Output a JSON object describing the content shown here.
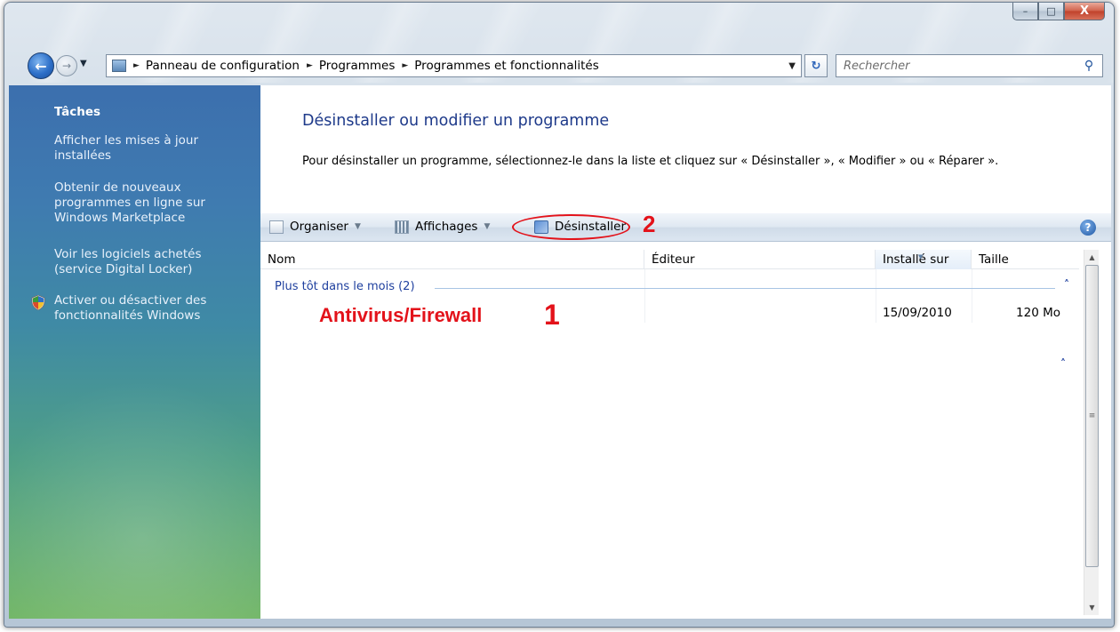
{
  "window": {
    "caption": {
      "minimize": "–",
      "maximize": "□",
      "close": "X"
    }
  },
  "nav": {
    "back_glyph": "←",
    "forward_glyph": "→",
    "breadcrumbs": [
      "Panneau de configuration",
      "Programmes",
      "Programmes et fonctionnalités"
    ],
    "breadcrumb_separator": "►",
    "refresh_glyph": "↻",
    "search_placeholder": "Rechercher"
  },
  "sidebar": {
    "title": "Tâches",
    "links": [
      "Afficher les mises à jour installées",
      "Obtenir de nouveaux programmes en ligne sur Windows Marketplace",
      "Voir les logiciels achetés (service Digital Locker)",
      "Activer ou désactiver des fonctionnalités Windows"
    ]
  },
  "main": {
    "title": "Désinstaller ou modifier un programme",
    "description": "Pour désinstaller un programme, sélectionnez-le dans la liste et cliquez sur « Désinstaller », « Modifier » ou « Réparer ».",
    "toolbar": {
      "organize": "Organiser",
      "views": "Affichages",
      "uninstall": "Désinstaller",
      "help_glyph": "?"
    },
    "columns": [
      "Nom",
      "Éditeur",
      "Installé sur",
      "Taille"
    ],
    "group": {
      "label": "Plus tôt dans le mois (2)"
    },
    "rows": [
      {
        "name": "Antivirus/Firewall",
        "publisher": "",
        "installed_on": "15/09/2010",
        "size": "120 Mo"
      }
    ]
  },
  "annotations": {
    "step1": "1",
    "step2": "2",
    "color": "#e3121a"
  }
}
